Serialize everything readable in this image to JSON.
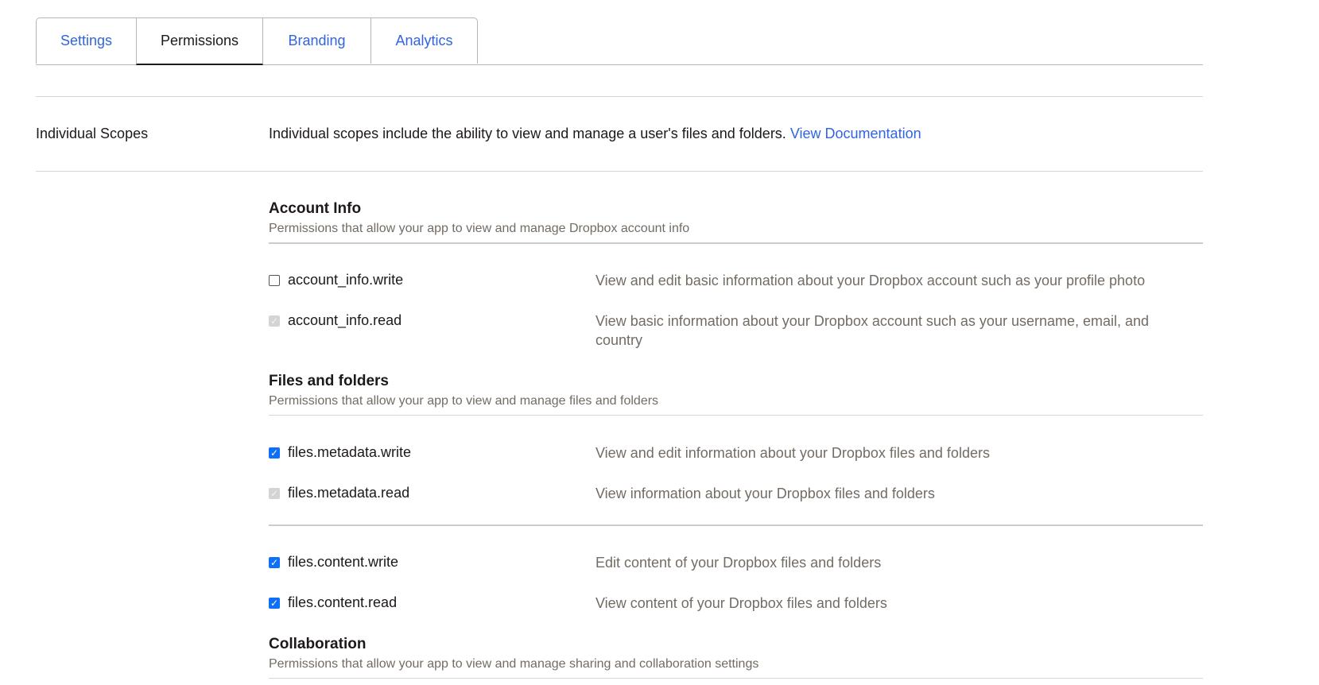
{
  "tabs": [
    {
      "label": "Settings",
      "active": false
    },
    {
      "label": "Permissions",
      "active": true
    },
    {
      "label": "Branding",
      "active": false
    },
    {
      "label": "Analytics",
      "active": false
    }
  ],
  "individual_scopes": {
    "label": "Individual Scopes",
    "intro": "Individual scopes include the ability to view and manage a user's files and folders.",
    "link": "View Documentation"
  },
  "sections": [
    {
      "title": "Account Info",
      "subtitle": "Permissions that allow your app to view and manage Dropbox account info",
      "scopes": [
        {
          "name": "account_info.write",
          "state": "unchecked",
          "description": "View and edit basic information about your Dropbox account such as your profile photo"
        },
        {
          "name": "account_info.read",
          "state": "checked-disabled",
          "description": "View basic information about your Dropbox account such as your username, email, and country"
        }
      ]
    },
    {
      "title": "Files and folders",
      "subtitle": "Permissions that allow your app to view and manage files and folders",
      "scopes": [
        {
          "name": "files.metadata.write",
          "state": "checked",
          "description": "View and edit information about your Dropbox files and folders"
        },
        {
          "name": "files.metadata.read",
          "state": "checked-disabled",
          "description": "View information about your Dropbox files and folders"
        },
        {
          "name": "files.content.write",
          "state": "checked",
          "description": "Edit content of your Dropbox files and folders"
        },
        {
          "name": "files.content.read",
          "state": "checked",
          "description": "View content of your Dropbox files and folders"
        }
      ]
    },
    {
      "title": "Collaboration",
      "subtitle": "Permissions that allow your app to view and manage sharing and collaboration settings",
      "scopes": []
    }
  ],
  "colors": {
    "link": "#3164e0",
    "checkbox_checked": "#0e6ff7",
    "checkbox_disabled": "#d4d4d4"
  }
}
